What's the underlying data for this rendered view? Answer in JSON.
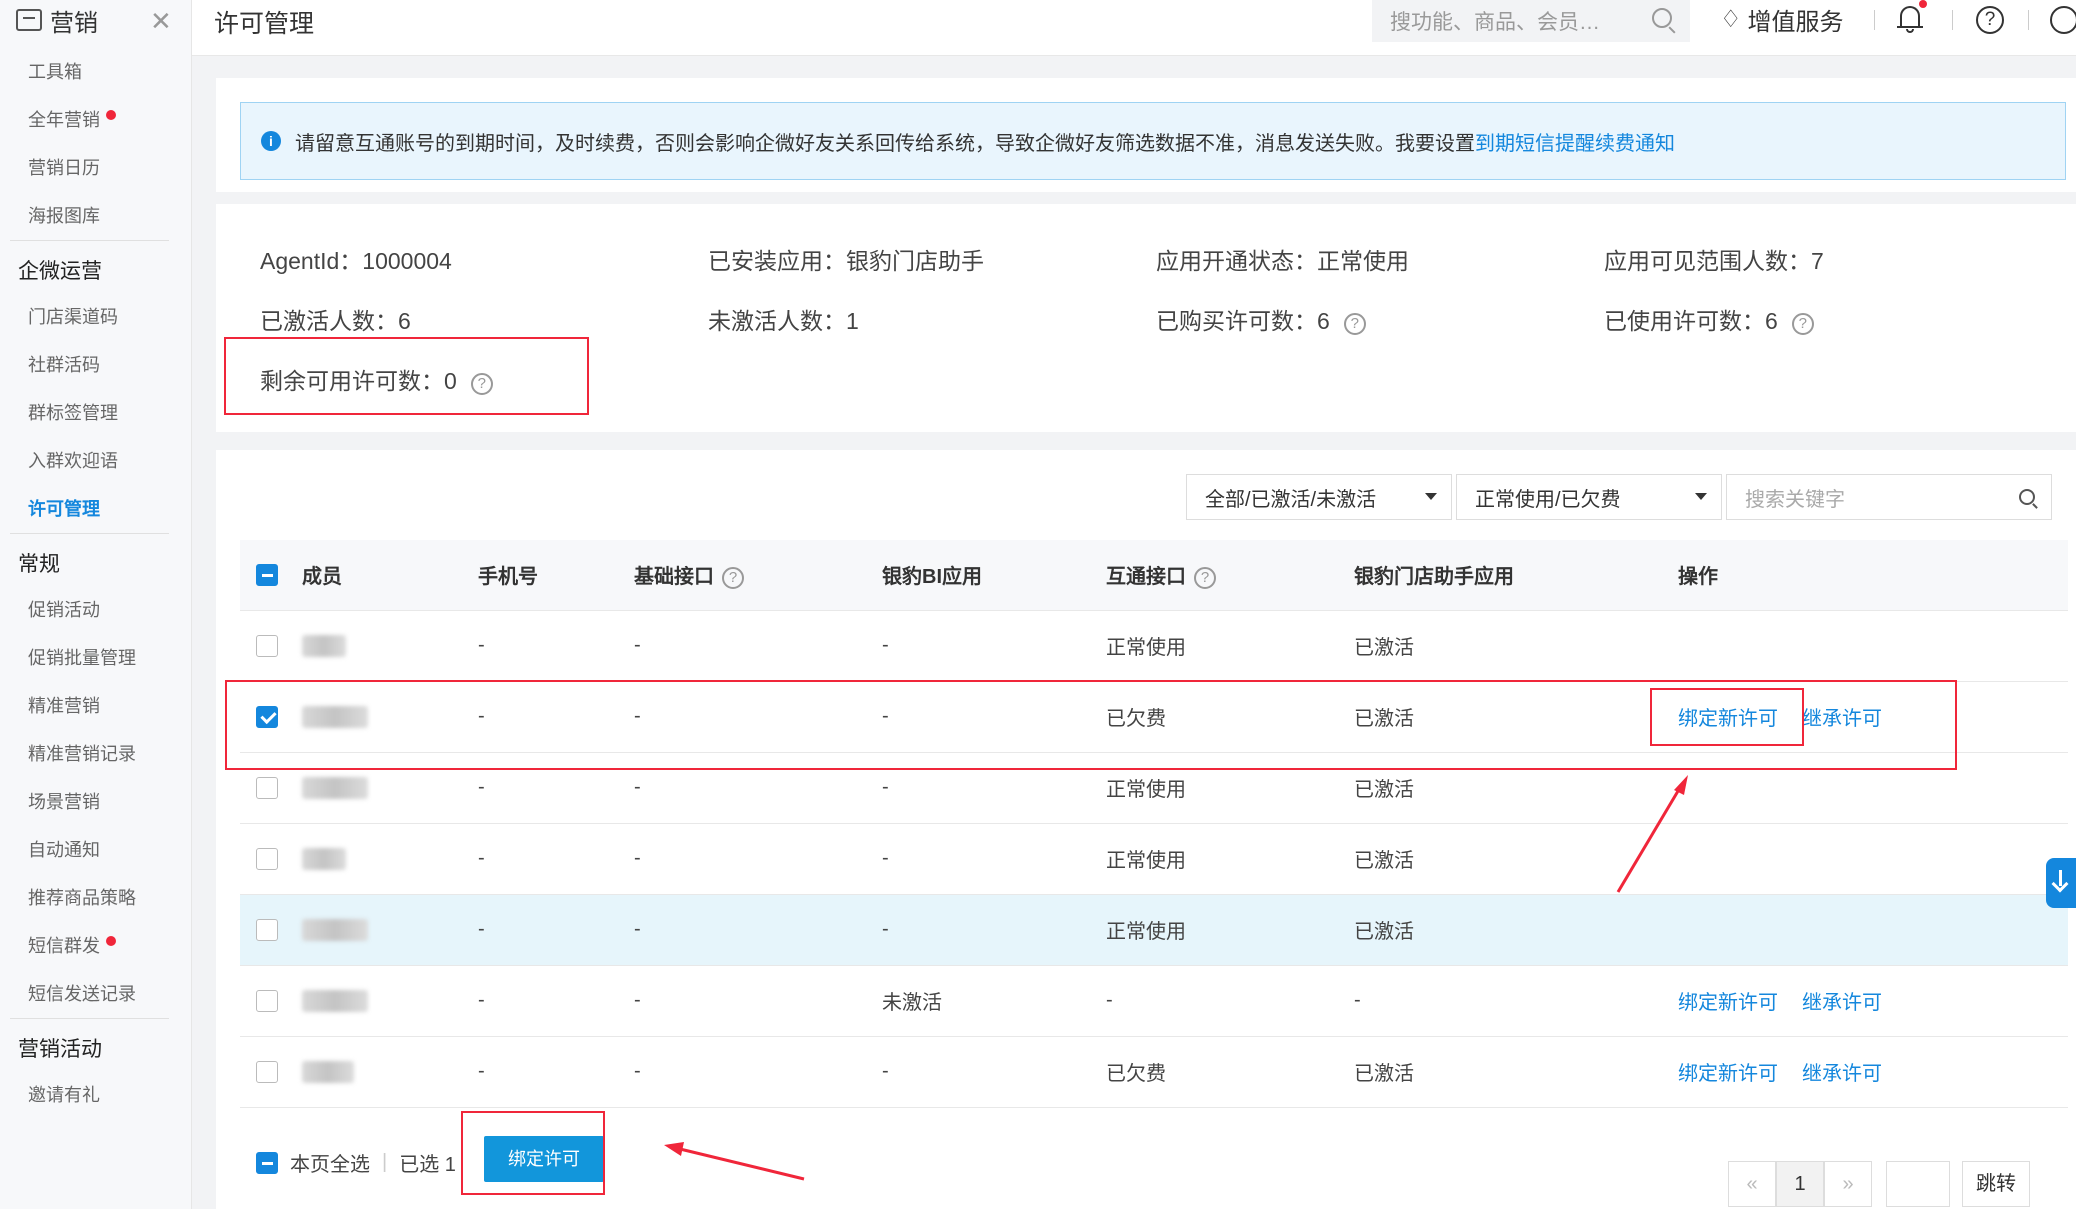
{
  "sidebar": {
    "brand": "营销",
    "close": "✕",
    "group1_items": [
      {
        "label": "工具箱",
        "dot": false
      },
      {
        "label": "全年营销",
        "dot": true
      },
      {
        "label": "营销日历",
        "dot": false
      },
      {
        "label": "海报图库",
        "dot": false
      }
    ],
    "group2_title": "企微运营",
    "group2_items": [
      {
        "label": "门店渠道码"
      },
      {
        "label": "社群活码"
      },
      {
        "label": "群标签管理"
      },
      {
        "label": "入群欢迎语"
      },
      {
        "label": "许可管理",
        "active": true
      }
    ],
    "group3_title": "常规",
    "group3_items": [
      {
        "label": "促销活动",
        "dot": false
      },
      {
        "label": "促销批量管理",
        "dot": false
      },
      {
        "label": "精准营销",
        "dot": false
      },
      {
        "label": "精准营销记录",
        "dot": false
      },
      {
        "label": "场景营销",
        "dot": false
      },
      {
        "label": "自动通知",
        "dot": false
      },
      {
        "label": "推荐商品策略",
        "dot": false
      },
      {
        "label": "短信群发",
        "dot": true
      },
      {
        "label": "短信发送记录",
        "dot": false
      }
    ],
    "group4_title": "营销活动",
    "group4_items": [
      {
        "label": "邀请有礼"
      }
    ]
  },
  "topbar": {
    "title": "许可管理",
    "search_placeholder": "搜功能、商品、会员…",
    "value_added": "增值服务",
    "help": "?"
  },
  "notice": {
    "icon": "i",
    "text": "请留意互通账号的到期时间，及时续费，否则会影响企微好友关系回传给系统，导致企微好友筛选数据不准，消息发送失败。我要设置",
    "link": "到期短信提醒续费通知"
  },
  "stats": {
    "agent_id": "AgentId：1000004",
    "installed_app": "已安装应用：银豹门店助手",
    "app_status": "应用开通状态：正常使用",
    "visible_count": "应用可见范围人数：7",
    "activated": "已激活人数：6",
    "not_activated": "未激活人数：1",
    "purchased": "已购买许可数：6",
    "used": "已使用许可数：6",
    "remaining": "剩余可用许可数：0",
    "help": "?"
  },
  "filters": {
    "activation": "全部/已激活/未激活",
    "status": "正常使用/已欠费",
    "search_placeholder": "搜索关键字"
  },
  "table": {
    "headers": [
      "成员",
      "手机号",
      "基础接口",
      "银豹BI应用",
      "互通接口",
      "银豹门店助手应用",
      "操作"
    ],
    "rows": [
      {
        "phone": "-",
        "basic": "-",
        "bi": "-",
        "interop": "正常使用",
        "assistant": "已激活",
        "bind": "",
        "inherit": ""
      },
      {
        "phone": "-",
        "basic": "-",
        "bi": "-",
        "interop": "已欠费",
        "assistant": "已激活",
        "bind": "绑定新许可",
        "inherit": "继承许可"
      },
      {
        "phone": "-",
        "basic": "-",
        "bi": "-",
        "interop": "正常使用",
        "assistant": "已激活",
        "bind": "",
        "inherit": ""
      },
      {
        "phone": "-",
        "basic": "-",
        "bi": "-",
        "interop": "正常使用",
        "assistant": "已激活",
        "bind": "",
        "inherit": ""
      },
      {
        "phone": "-",
        "basic": "-",
        "bi": "-",
        "interop": "正常使用",
        "assistant": "已激活",
        "bind": "",
        "inherit": ""
      },
      {
        "phone": "-",
        "basic": "-",
        "bi": "未激活",
        "interop": "-",
        "assistant": "-",
        "bind": "绑定新许可",
        "inherit": "继承许可"
      },
      {
        "phone": "-",
        "basic": "-",
        "bi": "-",
        "interop": "已欠费",
        "assistant": "已激活",
        "bind": "绑定新许可",
        "inherit": "继承许可"
      }
    ]
  },
  "footer": {
    "select_all": "本页全选",
    "selected": "已选 1",
    "bind_button": "绑定许可"
  },
  "pagination": {
    "prev": "«",
    "current": "1",
    "next": "»",
    "jump": "跳转"
  },
  "colors": {
    "accent": "#1487dd",
    "annotation_red": "#f0263a",
    "button_blue": "#1296db"
  }
}
